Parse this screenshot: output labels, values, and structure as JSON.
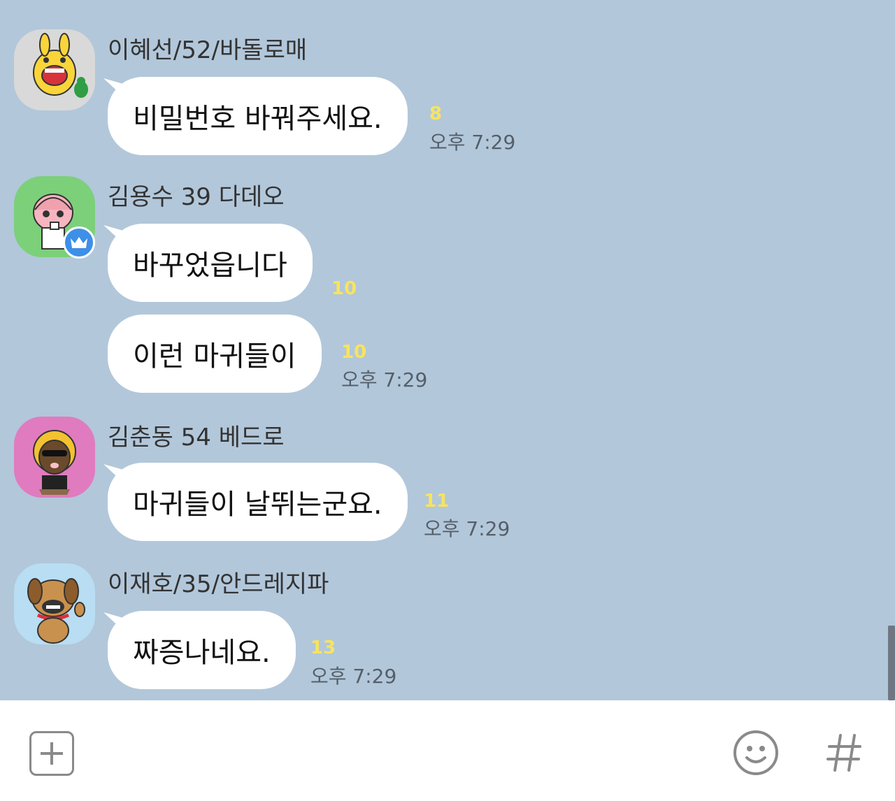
{
  "messages": [
    {
      "sender": "이혜선/52/바돌로매",
      "bubbles": [
        {
          "text": "비밀번호 바꿔주세요.",
          "unread": "8",
          "time": "오후 7:29"
        }
      ]
    },
    {
      "sender": "김용수 39 다데오",
      "bubbles": [
        {
          "text": "바꾸었읍니다",
          "unread": "10",
          "time": ""
        },
        {
          "text": "이런 마귀들이",
          "unread": "10",
          "time": "오후 7:29"
        }
      ]
    },
    {
      "sender": "김춘동 54 베드로",
      "bubbles": [
        {
          "text": "마귀들이 날뛰는군요.",
          "unread": "11",
          "time": "오후 7:29"
        }
      ]
    },
    {
      "sender": "이재호/35/안드레지파",
      "bubbles": [
        {
          "text": "짜증나네요.",
          "unread": "13",
          "time": "오후 7:29"
        }
      ]
    }
  ],
  "icons": {
    "attach": "plus-square-icon",
    "emoticon": "smiley-icon",
    "hashtag": "hash-icon",
    "host_badge": "crown-icon"
  },
  "colors": {
    "chat_background": "#b2c7da",
    "bubble": "#ffffff",
    "unread_count": "#f8e45c",
    "host_badge": "#3d8fe8"
  }
}
